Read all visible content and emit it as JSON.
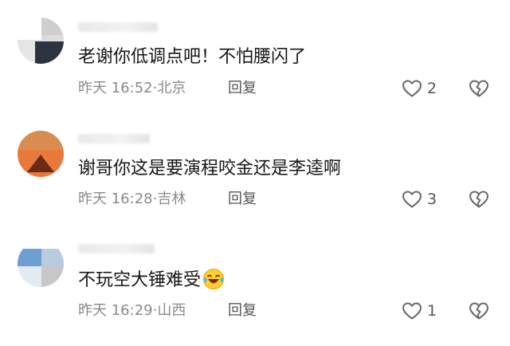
{
  "comments": [
    {
      "content": "老谢你低调点吧！不怕腰闪了",
      "time": "昨天 16:52",
      "separator": "·",
      "location": "北京",
      "reply_label": "回复",
      "likes": "2",
      "has_emoji": false
    },
    {
      "content": "谢哥你这是要演程咬金还是李逵啊",
      "time": "昨天 16:28",
      "separator": "·",
      "location": "吉林",
      "reply_label": "回复",
      "likes": "3",
      "has_emoji": false
    },
    {
      "content": "不玩空大锤难受",
      "time": "昨天 16:29",
      "separator": "·",
      "location": "山西",
      "reply_label": "回复",
      "likes": "1",
      "has_emoji": true,
      "emoji": "laughing-tears-emoji"
    }
  ],
  "icons": {
    "like": "heart-outline-icon",
    "dislike": "broken-heart-icon"
  },
  "colors": {
    "text": "#161616",
    "meta": "#8a8a8a",
    "action": "#555555"
  }
}
